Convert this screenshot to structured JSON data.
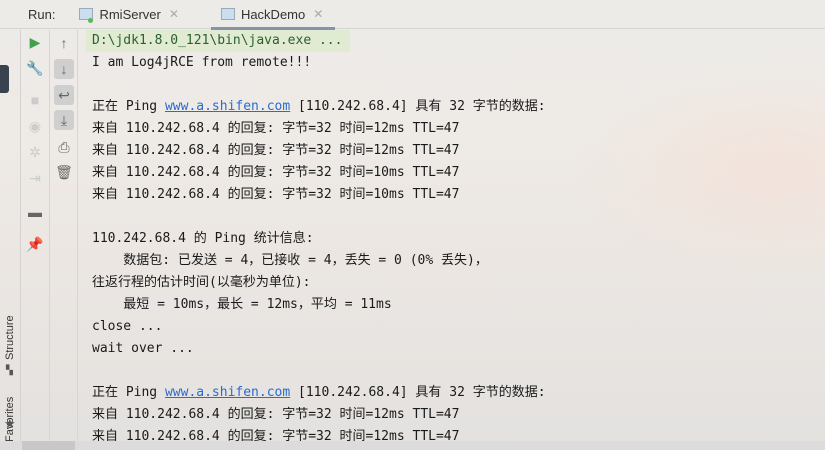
{
  "run_panel": {
    "label": "Run:",
    "tabs": [
      {
        "label": "RmiServer",
        "active": false
      },
      {
        "label": "HackDemo",
        "active": true
      }
    ]
  },
  "side_tools": {
    "structure": "Structure",
    "favorites": "Favorites"
  },
  "console": {
    "command": "D:\\jdk1.8.0_121\\bin\\java.exe ...",
    "lines": [
      "I am Log4jRCE from remote!!!",
      "",
      {
        "pre": "正在 Ping ",
        "link": "www.a.shifen.com",
        "post": " [110.242.68.4] 具有 32 字节的数据:"
      },
      "来自 110.242.68.4 的回复: 字节=32 时间=12ms TTL=47",
      "来自 110.242.68.4 的回复: 字节=32 时间=12ms TTL=47",
      "来自 110.242.68.4 的回复: 字节=32 时间=10ms TTL=47",
      "来自 110.242.68.4 的回复: 字节=32 时间=10ms TTL=47",
      "",
      "110.242.68.4 的 Ping 统计信息:",
      "    数据包: 已发送 = 4，已接收 = 4，丢失 = 0 (0% 丢失)，",
      "往返行程的估计时间(以毫秒为单位):",
      "    最短 = 10ms，最长 = 12ms，平均 = 11ms",
      "close ...",
      "wait over ...",
      "",
      {
        "pre": "正在 Ping ",
        "link": "www.a.shifen.com",
        "post": " [110.242.68.4] 具有 32 字节的数据:"
      },
      "来自 110.242.68.4 的回复: 字节=32 时间=12ms TTL=47",
      "来自 110.242.68.4 的回复: 字节=32 时间=12ms TTL=47"
    ]
  },
  "colors": {
    "run_green": "#3fa34d",
    "link": "#2a6bd0"
  }
}
